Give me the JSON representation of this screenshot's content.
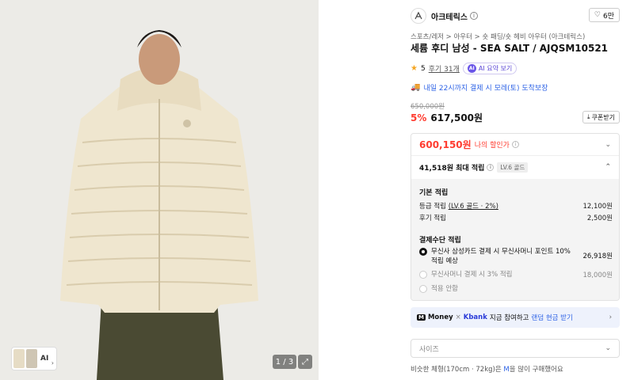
{
  "gallery": {
    "thumb_ai": "AI",
    "pager": "1 / 3"
  },
  "brand": {
    "logo_text": "ARC'TERYX",
    "name": "아크테릭스",
    "like_count": "6만"
  },
  "breadcrumb": "스포츠/레저 > 아우터 > 숏 패딩/숏 헤비 아우터 (아크테릭스)",
  "product": {
    "title": "세륨 후디 남성 - SEA SALT / AJQSM10521",
    "rating": "5",
    "reviews": "후기 31개",
    "ai_summary": "AI 요약 보기",
    "delivery": "내일 22시까지 결제 시 모레(토) 도착보장",
    "original_price": "650,000원",
    "discount": "5%",
    "price": "617,500원",
    "coupon_button": "쿠폰받기"
  },
  "benefits": {
    "sale_price": "600,150원",
    "sale_label": "나의 할인가",
    "points_max": "41,518원 최대 적립",
    "level_badge": "LV.6 골드",
    "basic_title": "기본 적립",
    "basic_lines": [
      {
        "label": "등급 적립 ",
        "level": "(LV.6 골드 · 2%)",
        "value": "12,100원"
      },
      {
        "label": "후기 적립",
        "value": "2,500원"
      }
    ],
    "payment_title": "결제수단 적립",
    "payment_options": [
      {
        "label": "무신사 삼성카드 결제 시 무신사머니 포인트 10% 적립 예상",
        "value": "26,918원",
        "selected": true
      },
      {
        "label": "무신사머니 결제 시 3% 적립",
        "value": "18,000원",
        "selected": false
      },
      {
        "label": "적용 안함",
        "value": "",
        "selected": false
      }
    ]
  },
  "kbank_banner": {
    "logo": "M",
    "money": "Money",
    "x": "×",
    "kbank": "Kbank",
    "text": "지금 참여하고",
    "highlight": "랜덤 현금 받기"
  },
  "size_select": {
    "placeholder": "사이즈"
  },
  "body_note": {
    "prefix": "비슷한 체형(170cm · 72kg)은 ",
    "size": "M",
    "suffix": "을 많이 구매했어요"
  },
  "colors": {
    "accent_red": "#ff3b2f",
    "accent_blue": "#2e63e6",
    "jacket": "#efe6cf"
  }
}
